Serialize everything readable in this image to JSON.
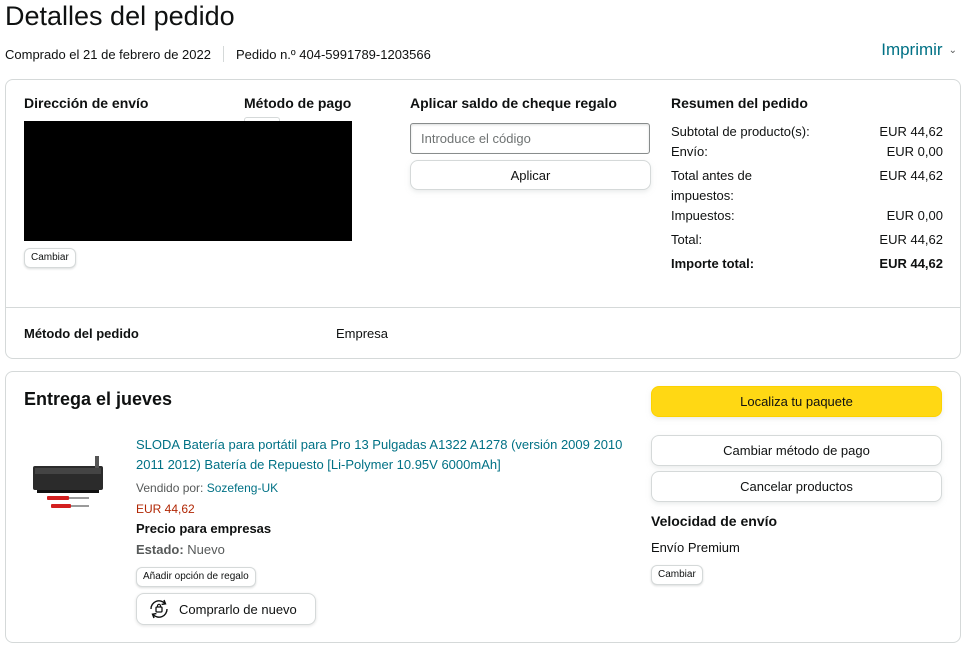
{
  "header": {
    "title": "Detalles del pedido",
    "purchased_on": "Comprado el 21 de febrero de 2022",
    "order_number": "Pedido n.º 404-5991789-1203566",
    "print_label": "Imprimir"
  },
  "order_box": {
    "shipping_address_title": "Dirección de envío",
    "payment_method_title": "Método de pago",
    "gift_card_title": "Aplicar saldo de cheque regalo",
    "gift_card_placeholder": "Introduce el código",
    "apply_label": "Aplicar",
    "change_label": "Cambiar",
    "summary_title": "Resumen del pedido",
    "summary": {
      "subtotal_label": "Subtotal de producto(s):",
      "subtotal_value": "EUR 44,62",
      "shipping_label": "Envío:",
      "shipping_value": "EUR 0,00",
      "pretax_label": "Total antes de impuestos:",
      "pretax_value": "EUR 44,62",
      "tax_label": "Impuestos:",
      "tax_value": "EUR 0,00",
      "total_label": "Total:",
      "total_value": "EUR 44,62",
      "grand_total_label": "Importe total:",
      "grand_total_value": "EUR 44,62"
    },
    "order_method_label": "Método del pedido",
    "order_method_value": "Empresa"
  },
  "delivery": {
    "title": "Entrega el jueves",
    "product_title": "SLODA Batería para portátil para Pro 13 Pulgadas A1322 A1278 (versión 2009 2010 2011 2012) Batería de Repuesto [Li-Polymer 10.95V 6000mAh]",
    "sold_by_label": "Vendido por:",
    "seller": "Sozefeng-UK",
    "price": "EUR 44,62",
    "business_price": "Precio para empresas",
    "condition_label": "Estado:",
    "condition_value": "Nuevo",
    "gift_option_label": "Añadir opción de regalo",
    "buy_again_label": "Comprarlo de nuevo",
    "track_label": "Localiza tu paquete",
    "change_payment_label": "Cambiar método de pago",
    "cancel_label": "Cancelar productos",
    "speed_title": "Velocidad de envío",
    "speed_value": "Envío Premium",
    "speed_change_label": "Cambiar"
  },
  "colors": {
    "link": "#007185",
    "price": "#b12704",
    "primary_button": "#ffd814",
    "border": "#d5d9d9"
  }
}
